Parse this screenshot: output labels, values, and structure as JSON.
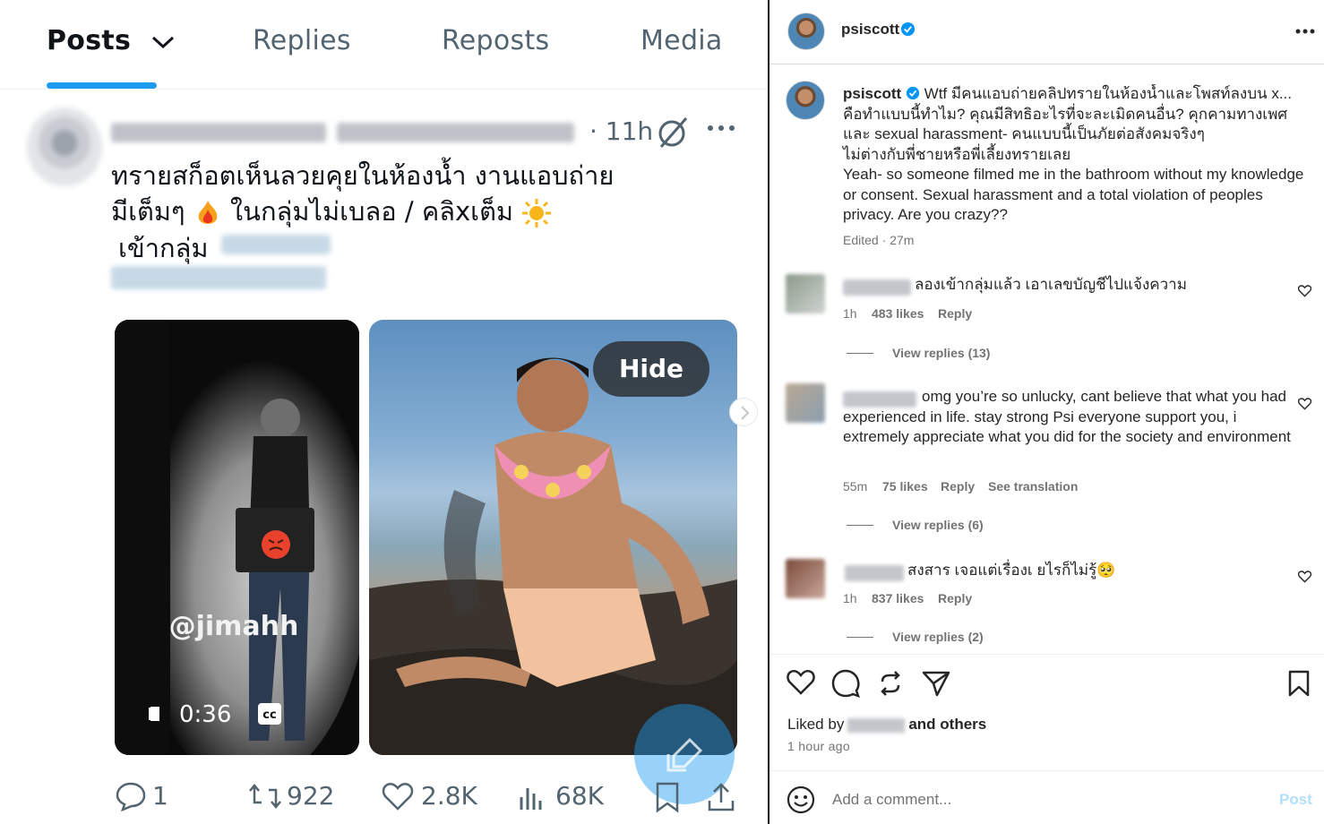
{
  "colors": {
    "x_accent": "#1d9bf0",
    "ig_verified": "#0095f6",
    "ig_post_disabled": "#b2dffc"
  },
  "x_post": {
    "tabs": [
      {
        "label": "Posts",
        "active": true
      },
      {
        "label": "Replies",
        "active": false
      },
      {
        "label": "Reposts",
        "active": false
      },
      {
        "label": "Media",
        "active": false
      }
    ],
    "time": "· 11h",
    "text_line1": "ทรายสก็อตเห็นลวยคุยในห้องน้ำ งานแอบถ่าย",
    "text_line2": "มีเต็มๆ",
    "text_line2b": "ในกลุ่มไม่เบลอ / คลิxเต็ม",
    "text_line3": "เข้ากลุ่ม",
    "video": {
      "watermark": "@jimahh",
      "timestamp": "0:36",
      "cc": "cc"
    },
    "hide_label": "Hide",
    "actions": {
      "replies": "1",
      "reposts": "922",
      "likes": "2.8K",
      "views": "68K"
    }
  },
  "ig": {
    "username": "psiscott",
    "caption": {
      "username": "psiscott",
      "thai_line1": "Wtf มีคนแอบถ่ายคลิปทรายในห้องน้ำและโพสท์ลงบน x...",
      "thai_line2": "คือทำแบบนี้ทำไม? คุณมีสิทธิอะไรที่จะละเมิดคนอื่น? คุกคามทางเพศ",
      "thai_line3": "และ sexual harassment- คนแบบนี้เป็นภัยต่อสังคมจริงๆ",
      "thai_line4": "ไม่ต่างกับพี่ชายหรือพี่เลี้ยงทรายเลย",
      "english": "Yeah- so someone filmed me in the bathroom without my knowledge or consent. Sexual harassment and a total violation of peoples privacy. Are you crazy??"
    },
    "edited": "Edited · 27m",
    "comments": [
      {
        "text": "ลองเข้ากลุ่มแล้ว เอาเลขบัญชีไปแจ้งความ",
        "time": "1h",
        "likes": "483 likes",
        "reply": "Reply",
        "view_replies": "View replies (13)"
      },
      {
        "text": "omg you’re so unlucky, cant believe that what you had experienced in life. stay strong Psi everyone support you, i extremely appreciate what you did for the society and environment",
        "time": "55m",
        "likes": "75 likes",
        "reply": "Reply",
        "translation": "See translation",
        "view_replies": "View replies (6)"
      },
      {
        "text": "สงสาร เจอแต่เรื่องเ ยไรก็ไม่รู้🥺",
        "time": "1h",
        "likes": "837 likes",
        "reply": "Reply",
        "view_replies": "View replies (2)"
      }
    ],
    "liked_by": "Liked by",
    "and_others": "and others",
    "time_ago": "1 hour ago",
    "add_comment_placeholder": "Add a comment...",
    "post_button": "Post"
  }
}
